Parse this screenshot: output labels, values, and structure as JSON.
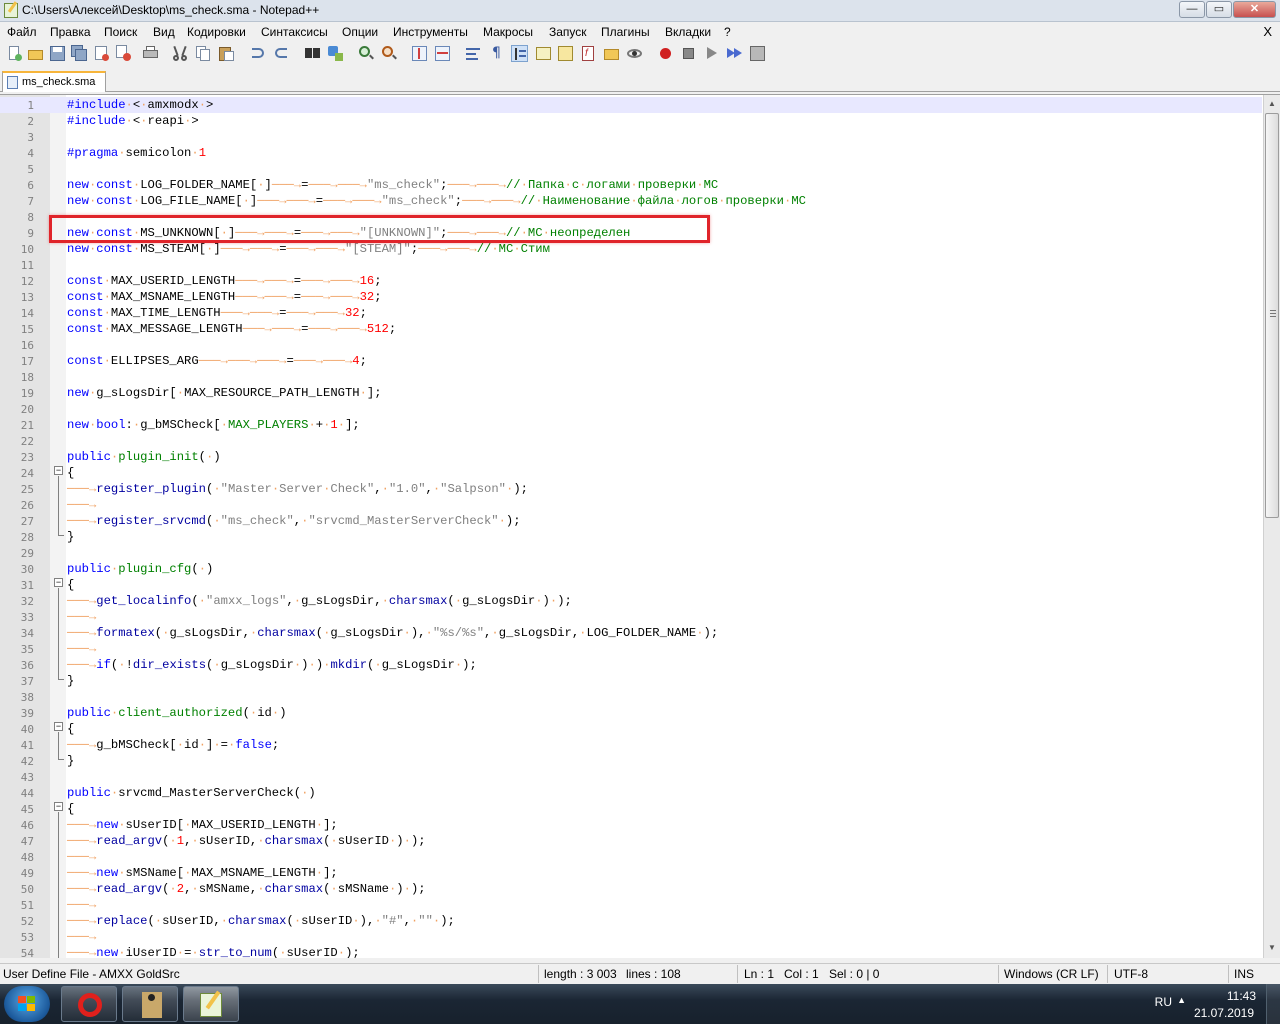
{
  "window": {
    "title": "C:\\Users\\Алексей\\Desktop\\ms_check.sma - Notepad++",
    "minimize": "—",
    "maximize": "▭",
    "close": "✕"
  },
  "menu": {
    "items": [
      "Файл",
      "Правка",
      "Поиск",
      "Вид",
      "Кодировки",
      "Синтаксисы",
      "Опции",
      "Инструменты",
      "Макросы",
      "Запуск",
      "Плагины",
      "Вкладки",
      "?"
    ],
    "close": "X"
  },
  "tab": {
    "label": "ms_check.sma"
  },
  "status": {
    "language": "User Define File - AMXX GoldSrc",
    "length": "length : 3 003",
    "lines": "lines : 108",
    "ln": "Ln : 1",
    "col": "Col : 1",
    "sel": "Sel : 0 | 0",
    "eol": "Windows (CR LF)",
    "encoding": "UTF-8",
    "mode": "INS"
  },
  "taskbar": {
    "lang": "RU",
    "time": "11:43",
    "date": "21.07.2019"
  },
  "colors": {
    "keyword": "#0000ff",
    "number": "#ff0000",
    "string": "#808080",
    "comment": "#008000",
    "highlight_box": "#e0242a"
  },
  "code": [
    {
      "n": "1",
      "html": "<span class=pre>#include</span><span class=ws>·</span>&lt;<span class=ws>·</span>amxmodx<span class=ws>·</span>&gt;"
    },
    {
      "n": "2",
      "html": "<span class=pre>#include</span><span class=ws>·</span>&lt;<span class=ws>·</span>reapi<span class=ws>·</span>&gt;"
    },
    {
      "n": "3",
      "html": ""
    },
    {
      "n": "4",
      "html": "<span class=pre>#pragma</span><span class=ws>·</span>semicolon<span class=ws>·</span><span class=n>1</span>"
    },
    {
      "n": "5",
      "html": ""
    },
    {
      "n": "6",
      "html": "<span class=k>new</span><span class=ws>·</span><span class=k>const</span><span class=ws>·</span>LOG_FOLDER_NAME[<span class=ws>·</span>]<span class=ws>───→</span>=<span class=ws>───→───→</span><span class=s>\"ms_check\"</span>;<span class=ws>───→───→</span><span class=c>//<span class=ws>·</span>Папка<span class=ws>·</span>с<span class=ws>·</span>логами<span class=ws>·</span>проверки<span class=ws>·</span>МС</span>"
    },
    {
      "n": "7",
      "html": "<span class=k>new</span><span class=ws>·</span><span class=k>const</span><span class=ws>·</span>LOG_FILE_NAME[<span class=ws>·</span>]<span class=ws>───→───→</span>=<span class=ws>───→───→</span><span class=s>\"ms_check\"</span>;<span class=ws>───→───→</span><span class=c>//<span class=ws>·</span>Наименование<span class=ws>·</span>файла<span class=ws>·</span>логов<span class=ws>·</span>проверки<span class=ws>·</span>МС</span>"
    },
    {
      "n": "8",
      "html": ""
    },
    {
      "n": "9",
      "html": "<span class=k>new</span><span class=ws>·</span><span class=k>const</span><span class=ws>·</span>MS_UNKNOWN[<span class=ws>·</span>]<span class=ws>───→───→</span>=<span class=ws>───→───→</span><span class=s>\"[UNKNOWN]\"</span>;<span class=ws>───→───→</span><span class=c>//<span class=ws>·</span>МС<span class=ws>·</span>неопределен</span>"
    },
    {
      "n": "10",
      "html": "<span class=k>new</span><span class=ws>·</span><span class=k>const</span><span class=ws>·</span>MS_STEAM[<span class=ws>·</span>]<span class=ws>───→───→</span>=<span class=ws>───→───→</span><span class=s>\"[STEAM]\"</span>;<span class=ws>───→───→</span><span class=c>//<span class=ws>·</span>МС<span class=ws>·</span>Стим</span>"
    },
    {
      "n": "11",
      "html": ""
    },
    {
      "n": "12",
      "html": "<span class=k>const</span><span class=ws>·</span>MAX_USERID_LENGTH<span class=ws>───→───→</span>=<span class=ws>───→───→</span><span class=n>16</span>;"
    },
    {
      "n": "13",
      "html": "<span class=k>const</span><span class=ws>·</span>MAX_MSNAME_LENGTH<span class=ws>───→───→</span>=<span class=ws>───→───→</span><span class=n>32</span>;"
    },
    {
      "n": "14",
      "html": "<span class=k>const</span><span class=ws>·</span>MAX_TIME_LENGTH<span class=ws>───→───→</span>=<span class=ws>───→───→</span><span class=n>32</span>;"
    },
    {
      "n": "15",
      "html": "<span class=k>const</span><span class=ws>·</span>MAX_MESSAGE_LENGTH<span class=ws>───→───→</span>=<span class=ws>───→───→</span><span class=n>512</span>;"
    },
    {
      "n": "16",
      "html": ""
    },
    {
      "n": "17",
      "html": "<span class=k>const</span><span class=ws>·</span>ELLIPSES_ARG<span class=ws>───→───→───→</span>=<span class=ws>───→───→</span><span class=n>4</span>;"
    },
    {
      "n": "18",
      "html": ""
    },
    {
      "n": "19",
      "html": "<span class=k>new</span><span class=ws>·</span>g_sLogsDir[<span class=ws>·</span>MAX_RESOURCE_PATH_LENGTH<span class=ws>·</span>];"
    },
    {
      "n": "20",
      "html": ""
    },
    {
      "n": "21",
      "html": "<span class=k>new</span><span class=ws>·</span><span class=k>bool</span>:<span class=ws>·</span>g_bMSCheck[<span class=ws>·</span><span class=m>MAX_PLAYERS</span><span class=ws>·</span>+<span class=ws>·</span><span class=n>1</span><span class=ws>·</span>];"
    },
    {
      "n": "22",
      "html": ""
    },
    {
      "n": "23",
      "html": "<span class=k>public</span><span class=ws>·</span><span class=m>plugin_init</span>(<span class=ws>·</span>)"
    },
    {
      "n": "24",
      "html": "{"
    },
    {
      "n": "25",
      "html": "<span class=ws>───→</span><span class=f>register_plugin</span>(<span class=ws>·</span><span class=s>\"Master<span class=ws>·</span>Server<span class=ws>·</span>Check\"</span>,<span class=ws>·</span><span class=s>\"1.0\"</span>,<span class=ws>·</span><span class=s>\"Salpson\"</span><span class=ws>·</span>);"
    },
    {
      "n": "26",
      "html": "<span class=ws>───→</span>"
    },
    {
      "n": "27",
      "html": "<span class=ws>───→</span><span class=f>register_srvcmd</span>(<span class=ws>·</span><span class=s>\"ms_check\"</span>,<span class=ws>·</span><span class=s>\"srvcmd_MasterServerCheck\"</span><span class=ws>·</span>);"
    },
    {
      "n": "28",
      "html": "}"
    },
    {
      "n": "29",
      "html": ""
    },
    {
      "n": "30",
      "html": "<span class=k>public</span><span class=ws>·</span><span class=m>plugin_cfg</span>(<span class=ws>·</span>)"
    },
    {
      "n": "31",
      "html": "{"
    },
    {
      "n": "32",
      "html": "<span class=ws>───→</span><span class=f>get_localinfo</span>(<span class=ws>·</span><span class=s>\"amxx_logs\"</span>,<span class=ws>·</span>g_sLogsDir,<span class=ws>·</span><span class=f>charsmax</span>(<span class=ws>·</span>g_sLogsDir<span class=ws>·</span>)<span class=ws>·</span>);"
    },
    {
      "n": "33",
      "html": "<span class=ws>───→</span>"
    },
    {
      "n": "34",
      "html": "<span class=ws>───→</span><span class=f>formatex</span>(<span class=ws>·</span>g_sLogsDir,<span class=ws>·</span><span class=f>charsmax</span>(<span class=ws>·</span>g_sLogsDir<span class=ws>·</span>),<span class=ws>·</span><span class=s>\"%s/%s\"</span>,<span class=ws>·</span>g_sLogsDir,<span class=ws>·</span>LOG_FOLDER_NAME<span class=ws>·</span>);"
    },
    {
      "n": "35",
      "html": "<span class=ws>───→</span>"
    },
    {
      "n": "36",
      "html": "<span class=ws>───→</span><span class=k>if</span>(<span class=ws>·</span>!<span class=f>dir_exists</span>(<span class=ws>·</span>g_sLogsDir<span class=ws>·</span>)<span class=ws>·</span>)<span class=ws>·</span><span class=f>mkdir</span>(<span class=ws>·</span>g_sLogsDir<span class=ws>·</span>);"
    },
    {
      "n": "37",
      "html": "}"
    },
    {
      "n": "38",
      "html": ""
    },
    {
      "n": "39",
      "html": "<span class=k>public</span><span class=ws>·</span><span class=m>client_authorized</span>(<span class=ws>·</span>id<span class=ws>·</span>)"
    },
    {
      "n": "40",
      "html": "{"
    },
    {
      "n": "41",
      "html": "<span class=ws>───→</span>g_bMSCheck[<span class=ws>·</span>id<span class=ws>·</span>]<span class=ws>·</span>=<span class=ws>·</span><span class=k>false</span>;"
    },
    {
      "n": "42",
      "html": "}"
    },
    {
      "n": "43",
      "html": ""
    },
    {
      "n": "44",
      "html": "<span class=k>public</span><span class=ws>·</span>srvcmd_MasterServerCheck(<span class=ws>·</span>)"
    },
    {
      "n": "45",
      "html": "{"
    },
    {
      "n": "46",
      "html": "<span class=ws>───→</span><span class=k>new</span><span class=ws>·</span>sUserID[<span class=ws>·</span>MAX_USERID_LENGTH<span class=ws>·</span>];"
    },
    {
      "n": "47",
      "html": "<span class=ws>───→</span><span class=f>read_argv</span>(<span class=ws>·</span><span class=n>1</span>,<span class=ws>·</span>sUserID,<span class=ws>·</span><span class=f>charsmax</span>(<span class=ws>·</span>sUserID<span class=ws>·</span>)<span class=ws>·</span>);"
    },
    {
      "n": "48",
      "html": "<span class=ws>───→</span>"
    },
    {
      "n": "49",
      "html": "<span class=ws>───→</span><span class=k>new</span><span class=ws>·</span>sMSName[<span class=ws>·</span>MAX_MSNAME_LENGTH<span class=ws>·</span>];"
    },
    {
      "n": "50",
      "html": "<span class=ws>───→</span><span class=f>read_argv</span>(<span class=ws>·</span><span class=n>2</span>,<span class=ws>·</span>sMSName,<span class=ws>·</span><span class=f>charsmax</span>(<span class=ws>·</span>sMSName<span class=ws>·</span>)<span class=ws>·</span>);"
    },
    {
      "n": "51",
      "html": "<span class=ws>───→</span>"
    },
    {
      "n": "52",
      "html": "<span class=ws>───→</span><span class=f>replace</span>(<span class=ws>·</span>sUserID,<span class=ws>·</span><span class=f>charsmax</span>(<span class=ws>·</span>sUserID<span class=ws>·</span>),<span class=ws>·</span><span class=s>\"#\"</span>,<span class=ws>·</span><span class=s>\"\"</span><span class=ws>·</span>);"
    },
    {
      "n": "53",
      "html": "<span class=ws>───→</span>"
    },
    {
      "n": "54",
      "html": "<span class=ws>───→</span><span class=k>new</span><span class=ws>·</span>iUserID<span class=ws>·</span>=<span class=ws>·</span><span class=f>str_to_num</span>(<span class=ws>·</span>sUserID<span class=ws>·</span>);"
    }
  ]
}
